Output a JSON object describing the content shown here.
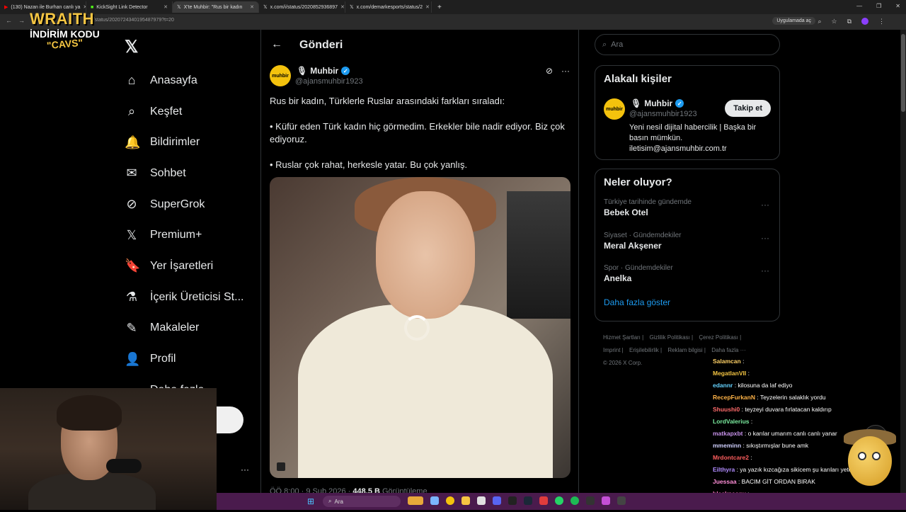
{
  "browser": {
    "tabs": [
      {
        "title": "(130) Nazan ile Burhan canlı ya",
        "active": false
      },
      {
        "title": "KickSight Link Detector",
        "active": false
      },
      {
        "title": "X'te Muhbir: \"Rus bir kadın",
        "active": true
      },
      {
        "title": "x.com/i/status/2020852936897",
        "active": false
      },
      {
        "title": "x.com/demarkesports/status/2",
        "active": false
      }
    ],
    "new_tab": "+",
    "url": "923/status/2020724340195487979?t=20",
    "open_in_app": "Uygulamada aç"
  },
  "overlay": {
    "brand": "WRAITH",
    "discount": "İNDİRİM KODU",
    "code": "\"CAVS\""
  },
  "sidebar": {
    "items": [
      {
        "label": "Anasayfa",
        "icon": "home-icon",
        "glyph": "⌂"
      },
      {
        "label": "Keşfet",
        "icon": "search-icon",
        "glyph": "⌕"
      },
      {
        "label": "Bildirimler",
        "icon": "bell-icon",
        "glyph": "🔔"
      },
      {
        "label": "Sohbet",
        "icon": "mail-icon",
        "glyph": "✉"
      },
      {
        "label": "SuperGrok",
        "icon": "grok-icon",
        "glyph": "⊘"
      },
      {
        "label": "Premium+",
        "icon": "x-premium-icon",
        "glyph": "𝕏"
      },
      {
        "label": "Yer İşaretleri",
        "icon": "bookmark-icon",
        "glyph": "🔖"
      },
      {
        "label": "İçerik Üreticisi St...",
        "icon": "flask-icon",
        "glyph": "⚗"
      },
      {
        "label": "Makaleler",
        "icon": "article-icon",
        "glyph": "✎"
      },
      {
        "label": "Profil",
        "icon": "person-icon",
        "glyph": "👤"
      },
      {
        "label": "Daha fazla",
        "icon": "more-icon",
        "glyph": "⋯"
      }
    ]
  },
  "main": {
    "header_title": "Gönderi",
    "author": {
      "name": "Muhbir",
      "handle": "@ajansmuhbir1923",
      "avatar_text": "muhbir"
    },
    "tweet_lines": [
      "Rus bir kadın, Türklerle Ruslar arasındaki farkları sıraladı:",
      "• Küfür eden Türk kadın hiç görmedim. Erkekler bile nadir ediyor. Biz çok ediyoruz.",
      "• Ruslar çok rahat, herkesle yatar. Bu çok yanlış."
    ],
    "meta": {
      "time": "ÖÖ 8:00 · 9 Şub 2026 · ",
      "views": "448,5 B",
      "views_label": " Görüntüleme"
    }
  },
  "right": {
    "search_placeholder": "Ara",
    "relevant": {
      "title": "Alakalı kişiler",
      "name": "Muhbir",
      "handle": "@ajansmuhbir1923",
      "follow_label": "Takip et",
      "bio": "Yeni nesil dijital habercilik | Başka bir basın mümkün. iletisim@ajansmuhbir.com.tr",
      "avatar_text": "muhbir"
    },
    "trends": {
      "title": "Neler oluyor?",
      "items": [
        {
          "context": "Türkiye tarihinde gündemde",
          "name": "Bebek Otel"
        },
        {
          "context": "Siyaset · Gündemdekiler",
          "name": "Meral Akşener"
        },
        {
          "context": "Spor · Gündemdekiler",
          "name": "Anelka"
        }
      ],
      "show_more": "Daha fazla göster"
    },
    "footer": {
      "links": [
        "Hizmet Şartları |",
        "Gizlilik Politikası |",
        "Çerez Politikası |",
        "Imprint |",
        "Erişilebilirlik |",
        "Reklam bilgisi |",
        "Daha fazla ···"
      ],
      "copyright": "© 2026 X Corp."
    }
  },
  "chat": [
    {
      "user": "Salamcan",
      "msg": ":",
      "color": "#ffd166"
    },
    {
      "user": "MegatlanVII",
      "msg": ":",
      "color": "#f4c542"
    },
    {
      "user": "edannr",
      "msg": ": kilosuna da laf ediyo",
      "color": "#64d2ff"
    },
    {
      "user": "RecepFurkanN",
      "msg": ": Teyzelerin salaklık yordu",
      "color": "#ffb347"
    },
    {
      "user": "Shuushi0",
      "msg": ": teyzeyi duvara fırlatacan kaldırıp",
      "color": "#ff6b6b"
    },
    {
      "user": "LordValerius",
      "msg": ":",
      "color": "#7bed9f"
    },
    {
      "user": "matkapxbt",
      "msg": ": o karılar umarım canlı canlı yanar",
      "color": "#c792ea"
    },
    {
      "user": "mmeminn",
      "msg": ": sıkıştırmışlar bune amk",
      "color": "#d0d0ff"
    },
    {
      "user": "Mrdontcare2",
      "msg": ":",
      "color": "#ff5e5e"
    },
    {
      "user": "Eilthyra",
      "msg": ": ya yazık kızcağıza sikicem şu karıları yeter ya",
      "color": "#b18cff"
    },
    {
      "user": "Juessaa",
      "msg": ": BACIM GİT ORDAN BIRAK",
      "color": "#ff8fd8"
    },
    {
      "user": "blackpeony",
      "msg": ":",
      "color": "#ff79c6"
    },
    {
      "user": "umutcc7",
      "msg": ":",
      "color": "#e0e0e0"
    }
  ],
  "taskbar": {
    "search_label": "Ara"
  }
}
